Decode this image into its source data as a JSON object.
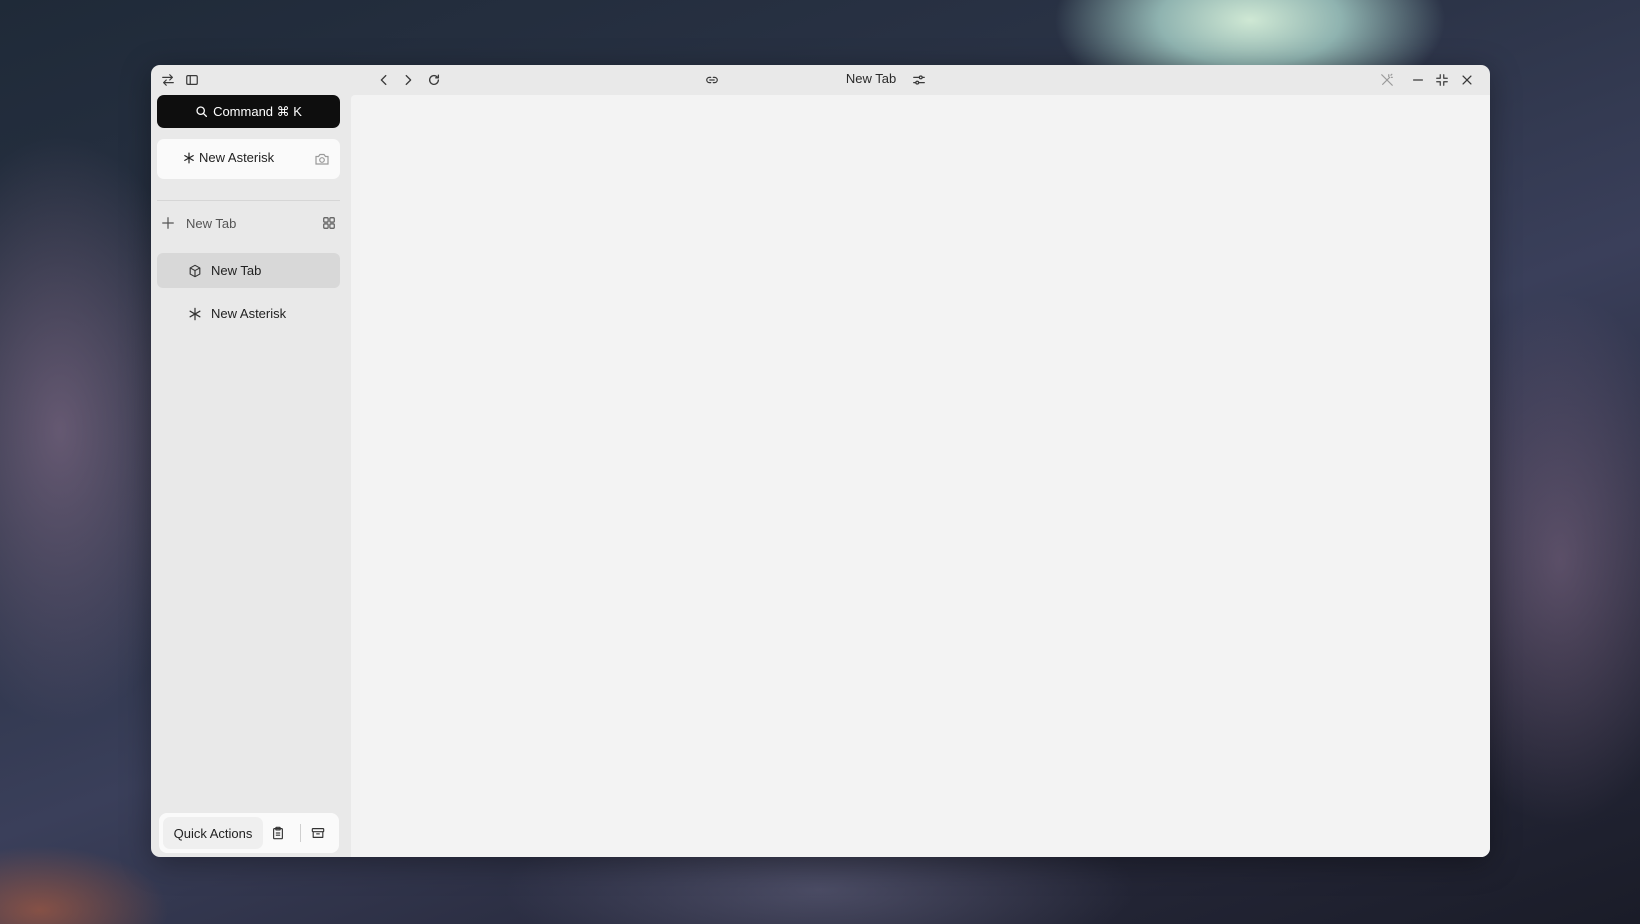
{
  "titlebar": {
    "tab_title": "New Tab",
    "icons": {
      "swap": "swap-arrows-icon",
      "sidebar": "sidebar-toggle-icon",
      "back": "chevron-left-icon",
      "forward": "chevron-right-icon",
      "reload": "reload-icon",
      "link": "link-icon",
      "settings": "sliders-icon",
      "magic": "magic-wand-icon",
      "minimize": "minimize-icon",
      "shrink": "shrink-icon",
      "close": "close-icon"
    }
  },
  "sidebar": {
    "command_label": "Command ⌘ K",
    "asterisk_card_label": "New Asterisk",
    "new_tab_label": "New Tab",
    "tabs": [
      {
        "label": "New Tab",
        "icon": "cube-icon",
        "active": true
      },
      {
        "label": "New Asterisk",
        "icon": "asterisk-icon",
        "active": false
      }
    ]
  },
  "bottom": {
    "quick_actions_label": "Quick Actions",
    "icons": [
      "clipboard-icon",
      "archive-icon"
    ]
  },
  "colors": {
    "window_bg": "#e9e9e9",
    "content_bg": "#f3f3f3",
    "command_bg": "#0e0e0e",
    "active_tab_bg": "#d8d8d8"
  }
}
